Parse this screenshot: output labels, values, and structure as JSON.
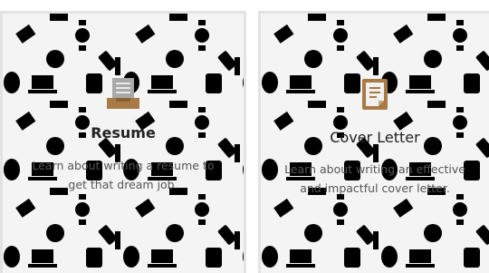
{
  "cards": [
    {
      "title": "Resume",
      "description": "Learn about writing a resume to get that dream job.",
      "icon": "resume-tray-icon"
    },
    {
      "title": "Cover Letter",
      "description": "Learn about writing an effective and impactful cover letter.",
      "icon": "document-icon"
    }
  ],
  "colors": {
    "card_background": "#f4f4f4",
    "card_border": "#e3e3e3",
    "pattern": "#e7e7e7",
    "icon_brown": "#a87a45",
    "icon_gray": "#a8a8a8"
  }
}
